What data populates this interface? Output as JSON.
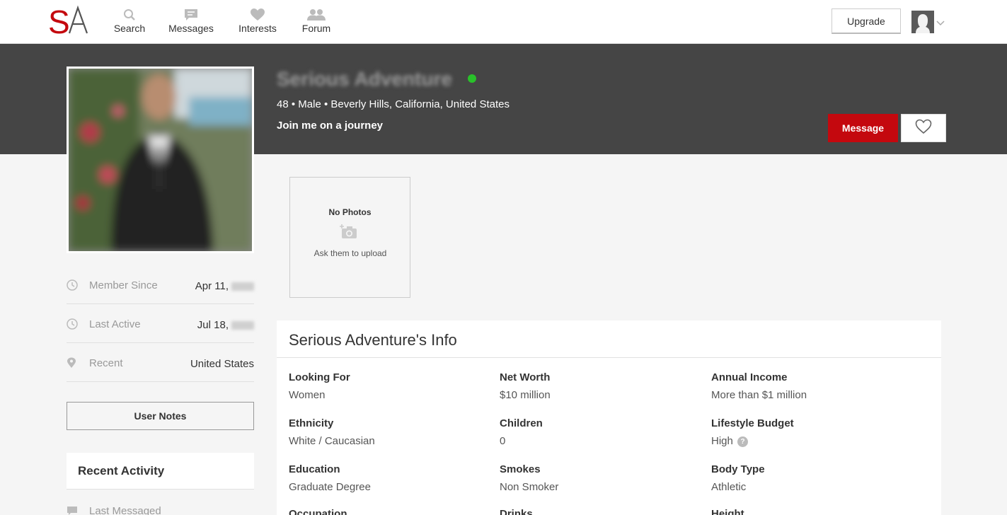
{
  "brand": {
    "logo_text": "SA",
    "logo_accent": "#c4080e"
  },
  "nav": {
    "items": [
      {
        "label": "Search",
        "icon": "search-icon"
      },
      {
        "label": "Messages",
        "icon": "messages-icon"
      },
      {
        "label": "Interests",
        "icon": "heart-icon"
      },
      {
        "label": "Forum",
        "icon": "people-icon"
      }
    ],
    "upgrade_label": "Upgrade"
  },
  "profile": {
    "name": "Serious Adventure",
    "online": true,
    "meta": "48 • Male • Beverly Hills, California, United States",
    "tagline": "Join me on a journey",
    "message_label": "Message"
  },
  "sidebar": {
    "rows": [
      {
        "label": "Member Since",
        "value": "Apr 11,",
        "icon": "clock-icon"
      },
      {
        "label": "Last Active",
        "value": "Jul 18,",
        "icon": "clock-icon"
      },
      {
        "label": "Recent",
        "value": "United States",
        "icon": "location-pin-icon"
      }
    ],
    "notes_label": "User Notes",
    "recent_activity_title": "Recent Activity",
    "last_messaged_label": "Last Messaged"
  },
  "photos": {
    "title": "No Photos",
    "subtitle": "Ask them to upload"
  },
  "info": {
    "title": "Serious Adventure's Info",
    "fields": [
      {
        "label": "Looking For",
        "value": "Women"
      },
      {
        "label": "Net Worth",
        "value": "$10 million"
      },
      {
        "label": "Annual Income",
        "value": "More than $1 million"
      },
      {
        "label": "Ethnicity",
        "value": "White / Caucasian"
      },
      {
        "label": "Children",
        "value": "0"
      },
      {
        "label": "Lifestyle Budget",
        "value": "High"
      },
      {
        "label": "Education",
        "value": "Graduate Degree"
      },
      {
        "label": "Smokes",
        "value": "Non Smoker"
      },
      {
        "label": "Body Type",
        "value": "Athletic"
      },
      {
        "label": "Occupation",
        "value": ""
      },
      {
        "label": "Drinks",
        "value": ""
      },
      {
        "label": "Height",
        "value": ""
      }
    ],
    "help_glyph": "?"
  },
  "colors": {
    "header_band": "#454545",
    "accent_red": "#c4080e",
    "online_green": "#29c12a"
  }
}
